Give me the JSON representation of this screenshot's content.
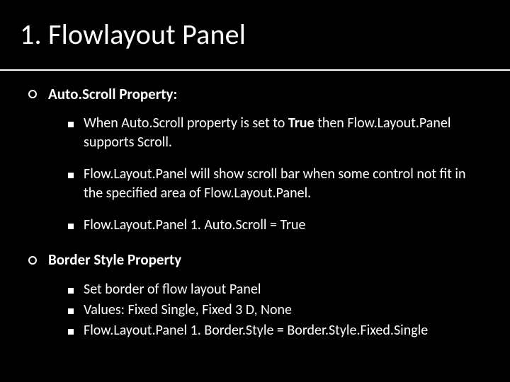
{
  "slide": {
    "title": "1. Flowlayout Panel",
    "bullets": [
      {
        "text": "Auto.Scroll Property:",
        "bold": true,
        "sub": [
          {
            "html": "When Auto.Scroll property is set to <strong>True</strong> then Flow.Layout.Panel supports Scroll."
          },
          {
            "text": "Flow.Layout.Panel will show scroll bar when some control not fit in the specified area of Flow.Layout.Panel."
          },
          {
            "text": "Flow.Layout.Panel 1. Auto.Scroll = True"
          }
        ]
      },
      {
        "text": "Border Style Property",
        "bold": true,
        "tight": true,
        "sub": [
          {
            "text": "Set border of flow layout Panel"
          },
          {
            "text": "Values: Fixed Single, Fixed 3 D, None"
          },
          {
            "text": "Flow.Layout.Panel 1. Border.Style = Border.Style.Fixed.Single"
          }
        ]
      }
    ]
  }
}
